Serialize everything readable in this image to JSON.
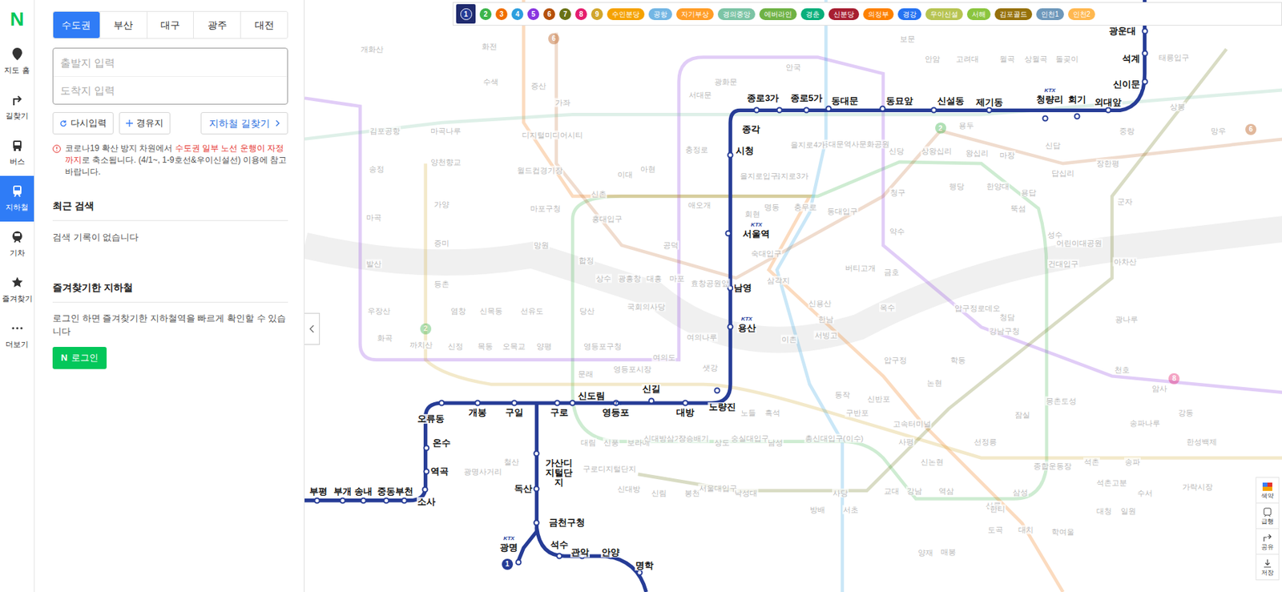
{
  "logo": "N",
  "rail": [
    {
      "label": "지도 홈",
      "selected": false
    },
    {
      "label": "길찾기",
      "selected": false
    },
    {
      "label": "버스",
      "selected": false
    },
    {
      "label": "지하철",
      "selected": true
    },
    {
      "label": "기차",
      "selected": false
    },
    {
      "label": "즐겨찾기",
      "selected": false
    },
    {
      "label": "더보기",
      "selected": false
    }
  ],
  "region_tabs": [
    {
      "label": "수도권",
      "selected": true
    },
    {
      "label": "부산",
      "selected": false
    },
    {
      "label": "대구",
      "selected": false
    },
    {
      "label": "광주",
      "selected": false
    },
    {
      "label": "대전",
      "selected": false
    }
  ],
  "search": {
    "origin_placeholder": "출발지 입력",
    "destination_placeholder": "도착지 입력"
  },
  "actions": {
    "reset": "다시입력",
    "waypoint": "경유지",
    "route": "지하철 길찾기"
  },
  "notice": [
    {
      "text": "코로나19 확산 방지 차원에서 ",
      "highlight": false
    },
    {
      "text": "수도권 일부 노선 운행이 자정까지",
      "highlight": true
    },
    {
      "text": "로 축소됩니다. (4/1~, 1-9호선&우이신설선) 이용에 참고 바랍니다.",
      "highlight": false
    }
  ],
  "recent": {
    "title": "최근 검색",
    "empty": "검색 기록이 없습니다"
  },
  "favorites": {
    "title": "즐겨찾기한 지하철",
    "message": "로그인 하면 즐겨찾기한 지하철역을 빠르게 확인할 수 있습니다",
    "login_logo": "N",
    "login": "로그인"
  },
  "line_chips": [
    {
      "label": "1",
      "kind": "number",
      "color": "#263c96",
      "selected": true
    },
    {
      "label": "2",
      "kind": "number",
      "color": "#3cb44a",
      "selected": false
    },
    {
      "label": "3",
      "kind": "number",
      "color": "#f06e00",
      "selected": false
    },
    {
      "label": "4",
      "kind": "number",
      "color": "#2c9ede",
      "selected": false
    },
    {
      "label": "5",
      "kind": "number",
      "color": "#8936e0",
      "selected": false
    },
    {
      "label": "6",
      "kind": "number",
      "color": "#b5500b",
      "selected": false
    },
    {
      "label": "7",
      "kind": "number",
      "color": "#697215",
      "selected": false
    },
    {
      "label": "8",
      "kind": "number",
      "color": "#e51e6e",
      "selected": false
    },
    {
      "label": "9",
      "kind": "number",
      "color": "#d1a62c",
      "selected": false
    },
    {
      "label": "수인분당",
      "kind": "pill",
      "color": "#f5a200",
      "selected": false
    },
    {
      "label": "공항",
      "kind": "pill",
      "color": "#73b6e4",
      "selected": false
    },
    {
      "label": "자기부상",
      "kind": "pill",
      "color": "#ff9d27",
      "selected": false
    },
    {
      "label": "경의중앙",
      "kind": "pill",
      "color": "#7cc4a5",
      "selected": false
    },
    {
      "label": "에버라인",
      "kind": "pill",
      "color": "#6fb245",
      "selected": false
    },
    {
      "label": "경춘",
      "kind": "pill",
      "color": "#08af7b",
      "selected": false
    },
    {
      "label": "신분당",
      "kind": "pill",
      "color": "#a71e31",
      "selected": false
    },
    {
      "label": "의정부",
      "kind": "pill",
      "color": "#fd8100",
      "selected": false
    },
    {
      "label": "경강",
      "kind": "pill",
      "color": "#2673f2",
      "selected": false
    },
    {
      "label": "우이신설",
      "kind": "pill",
      "color": "#b7c452",
      "selected": false
    },
    {
      "label": "서해",
      "kind": "pill",
      "color": "#8bc53f",
      "selected": false
    },
    {
      "label": "김포골드",
      "kind": "pill",
      "color": "#96710a",
      "selected": false
    },
    {
      "label": "인천1",
      "kind": "pill",
      "color": "#6e98bb",
      "selected": false
    },
    {
      "label": "인천2",
      "kind": "pill",
      "color": "#ffb850",
      "selected": false
    }
  ],
  "line1_stations": [
    {
      "name": "광운대",
      "badge": ""
    },
    {
      "name": "석계",
      "badge": ""
    },
    {
      "name": "신이문",
      "badge": ""
    },
    {
      "name": "외대앞",
      "badge": ""
    },
    {
      "name": "회기",
      "badge": ""
    },
    {
      "name": "청량리",
      "badge": "KTX"
    },
    {
      "name": "제기동",
      "badge": ""
    },
    {
      "name": "신설동",
      "badge": ""
    },
    {
      "name": "동묘앞",
      "badge": ""
    },
    {
      "name": "동대문",
      "badge": ""
    },
    {
      "name": "종로5가",
      "badge": ""
    },
    {
      "name": "종로3가",
      "badge": ""
    },
    {
      "name": "종각",
      "badge": ""
    },
    {
      "name": "시청",
      "badge": ""
    },
    {
      "name": "서울역",
      "badge": "KTX"
    },
    {
      "name": "남영",
      "badge": ""
    },
    {
      "name": "용산",
      "badge": "KTX"
    },
    {
      "name": "노량진",
      "badge": ""
    },
    {
      "name": "대방",
      "badge": ""
    },
    {
      "name": "신길",
      "badge": ""
    },
    {
      "name": "영등포",
      "badge": "KTX"
    },
    {
      "name": "신도림",
      "badge": ""
    },
    {
      "name": "구로",
      "badge": ""
    },
    {
      "name": "구일",
      "badge": ""
    },
    {
      "name": "개봉",
      "badge": ""
    },
    {
      "name": "오류동",
      "badge": ""
    },
    {
      "name": "온수",
      "badge": ""
    },
    {
      "name": "역곡",
      "badge": ""
    },
    {
      "name": "소사",
      "badge": ""
    },
    {
      "name": "부천",
      "badge": ""
    },
    {
      "name": "중동",
      "badge": ""
    },
    {
      "name": "송내",
      "badge": ""
    },
    {
      "name": "부개",
      "badge": ""
    },
    {
      "name": "부평",
      "badge": ""
    },
    {
      "name": "가산디지털단지",
      "badge": ""
    },
    {
      "name": "독산",
      "badge": ""
    },
    {
      "name": "금천구청",
      "badge": ""
    },
    {
      "name": "광명",
      "badge": "KTX"
    },
    {
      "name": "석수",
      "badge": ""
    },
    {
      "name": "관악",
      "badge": ""
    },
    {
      "name": "안양",
      "badge": ""
    },
    {
      "name": "명학",
      "badge": ""
    }
  ],
  "other_stations": [
    "개화산",
    "김포공항",
    "송정",
    "마곡",
    "발산",
    "우장산",
    "화곡",
    "까치산",
    "신정",
    "목동",
    "오목교",
    "양평",
    "영등포구청",
    "영등포시장",
    "문래",
    "당산",
    "합정",
    "망원",
    "마포구청",
    "월드컵경기장",
    "디지털미디어시티",
    "가좌",
    "증산",
    "수색",
    "화전",
    "홍대입구",
    "신촌",
    "이대",
    "아현",
    "충정로",
    "서대문",
    "광화문",
    "애오개",
    "공덕",
    "마포",
    "대흥",
    "광흥창",
    "상수",
    "효창공원앞",
    "삼각지",
    "숙대입구",
    "신용산",
    "이촌",
    "서빙고",
    "한남",
    "옥수",
    "약수",
    "금호",
    "청구",
    "신당",
    "동대문역사문화공원",
    "을지로4가",
    "을지로3가",
    "을지로입구",
    "충무로",
    "동대입구",
    "버티고개",
    "회현",
    "명동",
    "안국",
    "동작",
    "구반포",
    "신반포",
    "고속터미널",
    "사평",
    "신논현",
    "논현",
    "학동",
    "압구정",
    "강남구청",
    "청담",
    "압구정로데오",
    "선정릉",
    "강남",
    "역삼",
    "선릉",
    "삼성",
    "종합운동장",
    "잠실",
    "대림",
    "신풍",
    "보라매",
    "신대방삼거리",
    "장승배기",
    "상도",
    "숭실대입구",
    "남성",
    "총신대입구(이수)",
    "사당",
    "구로디지털단지",
    "신대방",
    "신림",
    "봉천",
    "서울대입구",
    "낙성대",
    "방배",
    "서초",
    "교대",
    "양재",
    "보문",
    "안암",
    "고려대",
    "월곡",
    "상월곡",
    "돌곶이",
    "용두",
    "신답",
    "왕십리",
    "마장",
    "상왕십리",
    "답십리",
    "장한평",
    "한양대",
    "행당",
    "용답",
    "성수",
    "뚝섬",
    "건대입구",
    "군자",
    "어린이대공원",
    "아차산",
    "광나루",
    "천호",
    "암사",
    "강동",
    "상봉",
    "중랑",
    "망우",
    "태릉입구",
    "마곡나루",
    "양천향교",
    "가양",
    "증미",
    "등촌",
    "염창",
    "신목동",
    "선유도",
    "국회의사당",
    "여의도",
    "샛강",
    "여의나루",
    "노들",
    "흑석",
    "광명사거리",
    "철산",
    "석촌",
    "송파",
    "가락시장",
    "수서",
    "몽촌토성",
    "한성백제",
    "송파나루",
    "석촌고분",
    "대치",
    "도곡",
    "매봉",
    "한티",
    "학여울",
    "대청",
    "일원"
  ],
  "map_markers": [
    {
      "label": "1",
      "color": "#263c96",
      "faded": false
    },
    {
      "label": "2",
      "color": "#3cb44a",
      "faded": true
    },
    {
      "label": "2",
      "color": "#3cb44a",
      "faded": true
    },
    {
      "label": "6",
      "color": "#b5500b",
      "faded": true
    },
    {
      "label": "6",
      "color": "#b5500b",
      "faded": true
    },
    {
      "label": "8",
      "color": "#e51e6e",
      "faded": true
    }
  ],
  "tools": [
    "색약",
    "급행",
    "공유",
    "저장"
  ]
}
